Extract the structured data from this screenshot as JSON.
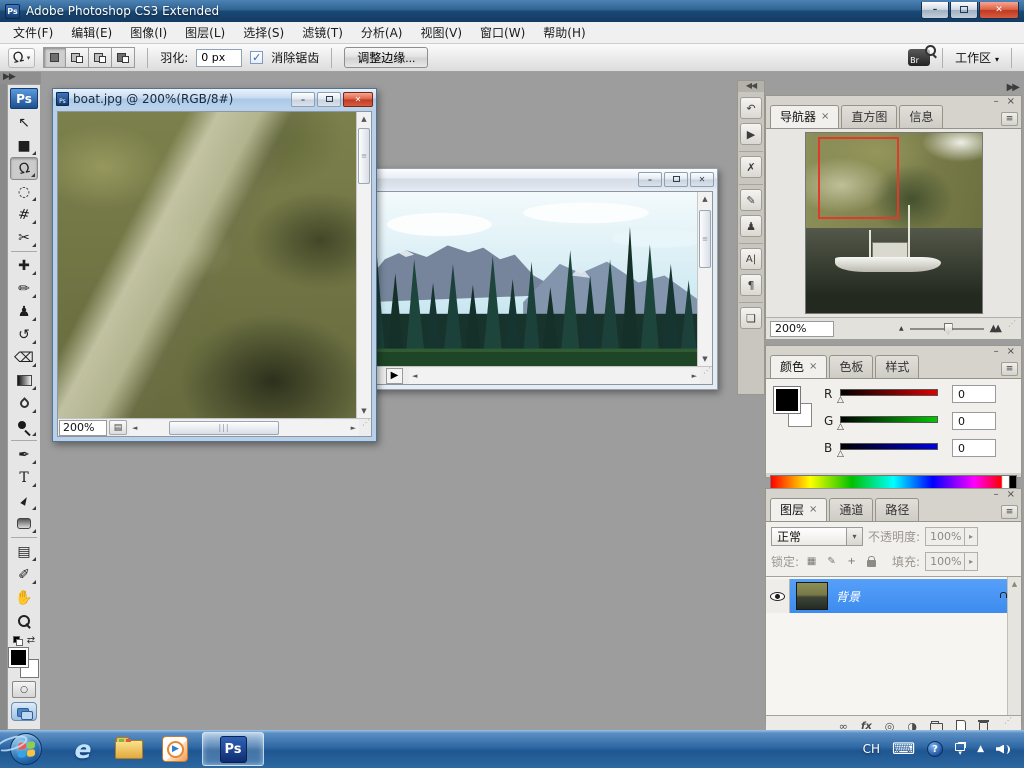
{
  "titlebar": {
    "title": "Adobe Photoshop CS3 Extended",
    "app_logo": "Ps"
  },
  "menu": {
    "items": [
      "文件(F)",
      "编辑(E)",
      "图像(I)",
      "图层(L)",
      "选择(S)",
      "滤镜(T)",
      "分析(A)",
      "视图(V)",
      "窗口(W)",
      "帮助(H)"
    ]
  },
  "options": {
    "feather_label": "羽化:",
    "feather_value": "0 px",
    "antialias_label": "消除锯齿",
    "refine_edge_label": "调整边缘...",
    "bridge_label": "Br",
    "workspace_label": "工作区"
  },
  "doc1": {
    "title": "boat.jpg @ 200%(RGB/8#)",
    "zoom": "200%",
    "file_icon": "Ps"
  },
  "navigator": {
    "tab_active": "导航器",
    "tab_histogram": "直方图",
    "tab_info": "信息",
    "zoom": "200%"
  },
  "colors": {
    "tab_active": "颜色",
    "tab_swatches": "色板",
    "tab_styles": "样式",
    "r_label": "R",
    "r_value": "0",
    "g_label": "G",
    "g_value": "0",
    "b_label": "B",
    "b_value": "0"
  },
  "layers": {
    "tab_active": "图层",
    "tab_channels": "通道",
    "tab_paths": "路径",
    "blend_mode": "正常",
    "opacity_label": "不透明度:",
    "opacity_value": "100%",
    "lock_label": "锁定:",
    "fill_label": "填充:",
    "fill_value": "100%",
    "bg_layer_name": "背景",
    "fx_label": "fx"
  },
  "taskbar": {
    "lang": "CH",
    "ps_label": "Ps",
    "ie_label": "e"
  },
  "icons": {
    "win_min": "–",
    "win_close": "✕",
    "tab_close": "×",
    "panel_min": "–",
    "panel_close": "×",
    "panel_menu": "≡",
    "dropdown": "▾",
    "check": "✓",
    "lasso": "Ω",
    "move": "↖",
    "marquee": "■",
    "quick_select": "◌",
    "crop": "#",
    "slice": "✂",
    "healing": "✚",
    "brush": "✏",
    "clone": "♟",
    "history": "↺",
    "eraser": "⌫",
    "pen": "✒",
    "type": "T",
    "path_select": "►",
    "notes": "▤",
    "eyedropper": "✐",
    "hand": "✋",
    "swap": "⇄",
    "quickmask": "○",
    "scroll_up": "▲",
    "scroll_down": "▼",
    "scroll_left": "◄",
    "scroll_right": "►",
    "thumb_grip_v": "≡",
    "thumb_grip_h": "|||",
    "resize_grip": "⋰",
    "status_flyout": "▶",
    "status_page": "▤",
    "dock_collapse_left": "◀◀",
    "dock_collapse_right": "▶▶",
    "history_panel": "↶",
    "actions_panel": "▶",
    "tool_presets_panel": "✗",
    "brushes_panel": "✎",
    "clone_source_panel": "♟",
    "character_panel": "A|",
    "paragraph_panel": "¶",
    "layer_comps_panel": "❏",
    "zoom_out_mountains": "▲",
    "zoom_in_mountains": "▲▲",
    "rgb_slider_thumb": "△",
    "lock_transparency": "▦",
    "lock_paint": "✎",
    "lock_position": "+",
    "spinner_arrow": "▸",
    "link_layers": "∞",
    "layer_mask": "◎",
    "adjustment_layer": "◑",
    "list_scroll_up": "▲",
    "keyboard": "⌨",
    "help": "?",
    "tray_show": "▲",
    "ime_arrow": "▾",
    "wmp_play": "▶"
  }
}
